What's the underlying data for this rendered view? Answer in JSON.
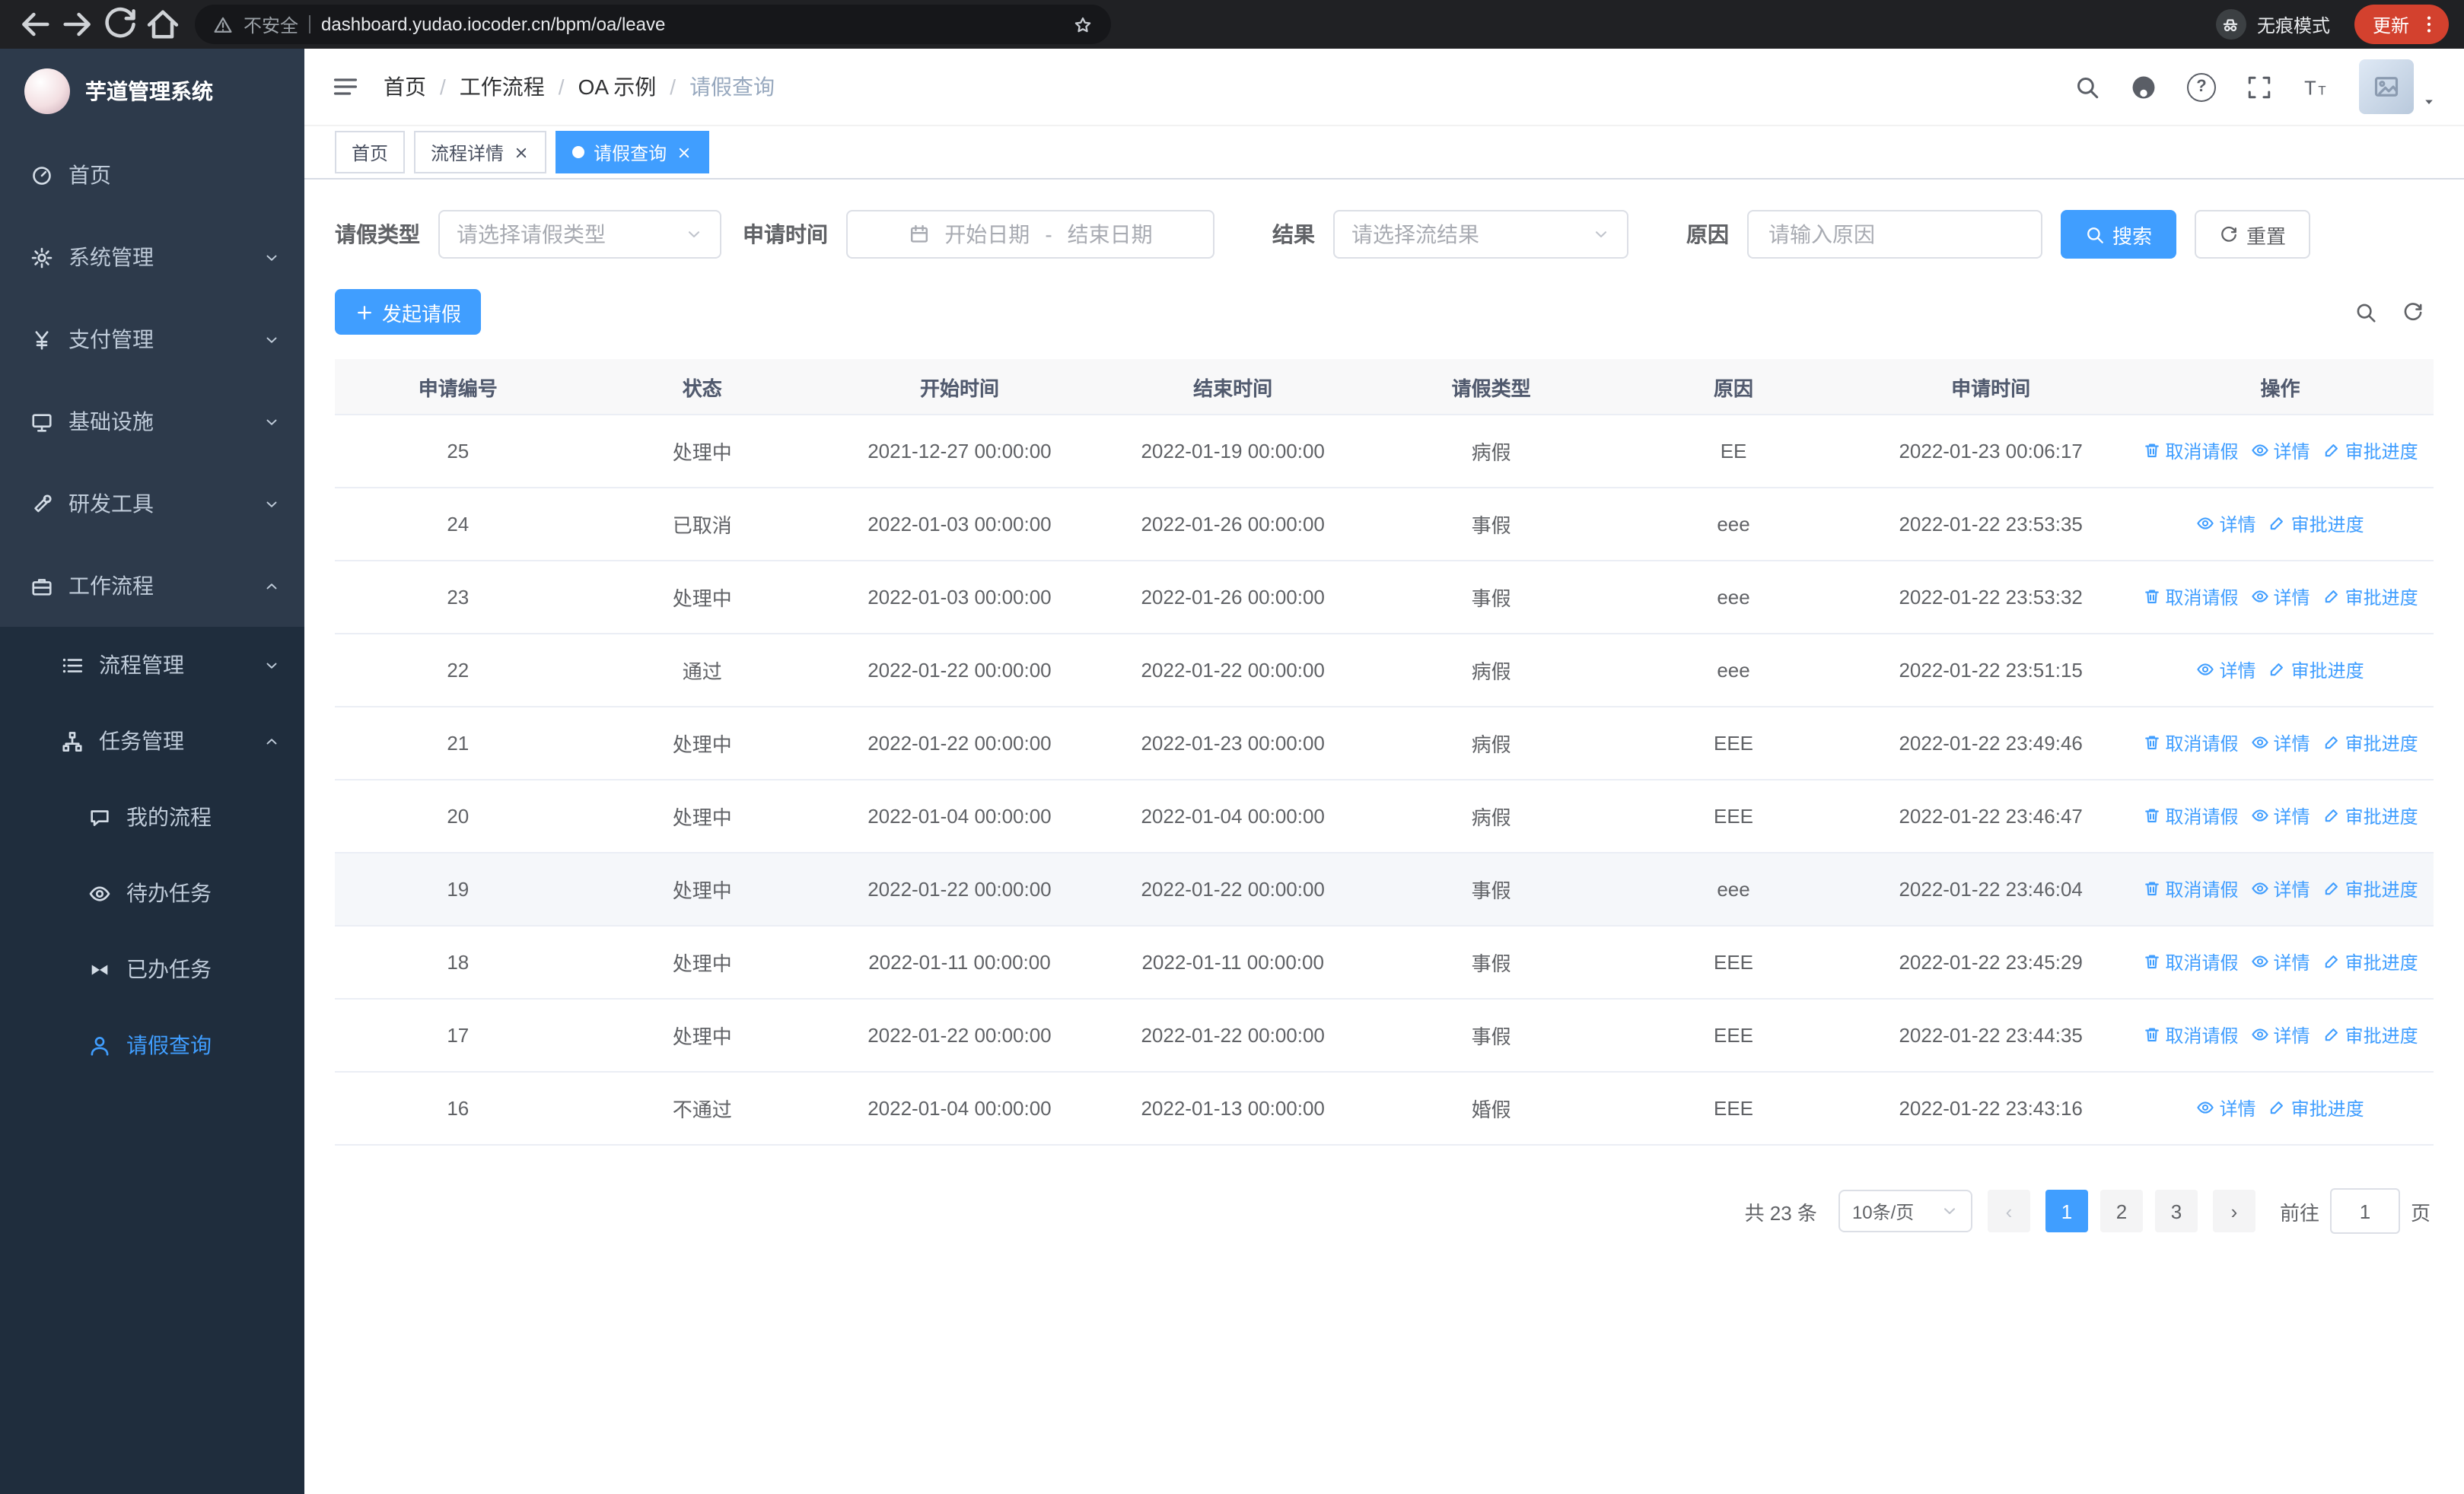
{
  "colors": {
    "primary": "#409eff",
    "sidebar_bg": "#2d3a4b",
    "submenu_bg": "#1f2d3d",
    "sidebar_text": "#bfcbd9",
    "browser_bar_bg": "#202124",
    "update_button_bg": "#d3412e",
    "table_header_bg": "#f8f8f9",
    "body_text": "#606266"
  },
  "browser": {
    "security_warning": "不安全",
    "url": "dashboard.yudao.iocoder.cn/bpm/oa/leave",
    "incognito_label": "无痕模式",
    "update_button": "更新"
  },
  "sidebar": {
    "logo_title": "芋道管理系统",
    "menu": [
      {
        "key": "home",
        "label": "首页",
        "icon": "dashboard-icon",
        "level": 1
      },
      {
        "key": "system",
        "label": "系统管理",
        "icon": "gear-icon",
        "level": 1,
        "arrow": "down"
      },
      {
        "key": "payment",
        "label": "支付管理",
        "icon": "yen-icon",
        "level": 1,
        "arrow": "down"
      },
      {
        "key": "infra",
        "label": "基础设施",
        "icon": "monitor-icon",
        "level": 1,
        "arrow": "down"
      },
      {
        "key": "devtools",
        "label": "研发工具",
        "icon": "wrench-icon",
        "level": 1,
        "arrow": "down"
      },
      {
        "key": "workflow",
        "label": "工作流程",
        "icon": "briefcase-icon",
        "level": 1,
        "arrow": "up"
      },
      {
        "key": "process-mgmt",
        "label": "流程管理",
        "icon": "list-icon",
        "level": 2,
        "arrow": "down"
      },
      {
        "key": "task-mgmt",
        "label": "任务管理",
        "icon": "tree-icon",
        "level": 2,
        "arrow": "up"
      },
      {
        "key": "my-process",
        "label": "我的流程",
        "icon": "chat-icon",
        "level": 3
      },
      {
        "key": "todo-tasks",
        "label": "待办任务",
        "icon": "eye-icon",
        "level": 3
      },
      {
        "key": "done-tasks",
        "label": "已办任务",
        "icon": "bowtie-icon",
        "level": 3
      },
      {
        "key": "leave-query",
        "label": "请假查询",
        "icon": "user-icon",
        "level": 3,
        "active": true
      }
    ]
  },
  "navbar": {
    "breadcrumb": [
      "首页",
      "工作流程",
      "OA 示例",
      "请假查询"
    ],
    "separator": "/"
  },
  "tabs": [
    {
      "label": "首页",
      "closable": false,
      "active": false
    },
    {
      "label": "流程详情",
      "closable": true,
      "active": false
    },
    {
      "label": "请假查询",
      "closable": true,
      "active": true
    }
  ],
  "filters": {
    "leave_type_label": "请假类型",
    "leave_type_placeholder": "请选择请假类型",
    "apply_time_label": "申请时间",
    "start_date_placeholder": "开始日期",
    "range_separator": "-",
    "end_date_placeholder": "结束日期",
    "result_label": "结果",
    "result_placeholder": "请选择流结果",
    "reason_label": "原因",
    "reason_placeholder": "请输入原因",
    "search_button": "搜索",
    "reset_button": "重置"
  },
  "toolbar": {
    "create_button": "发起请假"
  },
  "table": {
    "columns": [
      "申请编号",
      "状态",
      "开始时间",
      "结束时间",
      "请假类型",
      "原因",
      "申请时间",
      "操作"
    ],
    "action_labels": {
      "cancel": "取消请假",
      "detail": "详情",
      "progress": "审批进度"
    },
    "rows": [
      {
        "id": "25",
        "status": "处理中",
        "start": "2021-12-27 00:00:00",
        "end": "2022-01-19 00:00:00",
        "type": "病假",
        "reason": "EE",
        "apply_time": "2022-01-23 00:06:17",
        "actions": [
          "cancel",
          "detail",
          "progress"
        ]
      },
      {
        "id": "24",
        "status": "已取消",
        "start": "2022-01-03 00:00:00",
        "end": "2022-01-26 00:00:00",
        "type": "事假",
        "reason": "eee",
        "apply_time": "2022-01-22 23:53:35",
        "actions": [
          "detail",
          "progress"
        ]
      },
      {
        "id": "23",
        "status": "处理中",
        "start": "2022-01-03 00:00:00",
        "end": "2022-01-26 00:00:00",
        "type": "事假",
        "reason": "eee",
        "apply_time": "2022-01-22 23:53:32",
        "actions": [
          "cancel",
          "detail",
          "progress"
        ]
      },
      {
        "id": "22",
        "status": "通过",
        "start": "2022-01-22 00:00:00",
        "end": "2022-01-22 00:00:00",
        "type": "病假",
        "reason": "eee",
        "apply_time": "2022-01-22 23:51:15",
        "actions": [
          "detail",
          "progress"
        ]
      },
      {
        "id": "21",
        "status": "处理中",
        "start": "2022-01-22 00:00:00",
        "end": "2022-01-23 00:00:00",
        "type": "病假",
        "reason": "EEE",
        "apply_time": "2022-01-22 23:49:46",
        "actions": [
          "cancel",
          "detail",
          "progress"
        ]
      },
      {
        "id": "20",
        "status": "处理中",
        "start": "2022-01-04 00:00:00",
        "end": "2022-01-04 00:00:00",
        "type": "病假",
        "reason": "EEE",
        "apply_time": "2022-01-22 23:46:47",
        "actions": [
          "cancel",
          "detail",
          "progress"
        ]
      },
      {
        "id": "19",
        "status": "处理中",
        "start": "2022-01-22 00:00:00",
        "end": "2022-01-22 00:00:00",
        "type": "事假",
        "reason": "eee",
        "apply_time": "2022-01-22 23:46:04",
        "actions": [
          "cancel",
          "detail",
          "progress"
        ],
        "highlight": true
      },
      {
        "id": "18",
        "status": "处理中",
        "start": "2022-01-11 00:00:00",
        "end": "2022-01-11 00:00:00",
        "type": "事假",
        "reason": "EEE",
        "apply_time": "2022-01-22 23:45:29",
        "actions": [
          "cancel",
          "detail",
          "progress"
        ]
      },
      {
        "id": "17",
        "status": "处理中",
        "start": "2022-01-22 00:00:00",
        "end": "2022-01-22 00:00:00",
        "type": "事假",
        "reason": "EEE",
        "apply_time": "2022-01-22 23:44:35",
        "actions": [
          "cancel",
          "detail",
          "progress"
        ]
      },
      {
        "id": "16",
        "status": "不通过",
        "start": "2022-01-04 00:00:00",
        "end": "2022-01-13 00:00:00",
        "type": "婚假",
        "reason": "EEE",
        "apply_time": "2022-01-22 23:43:16",
        "actions": [
          "detail",
          "progress"
        ]
      }
    ]
  },
  "pagination": {
    "total": "共 23 条",
    "page_size": "10条/页",
    "pages": [
      "1",
      "2",
      "3"
    ],
    "active_page": "1",
    "goto_prefix": "前往",
    "goto_value": "1",
    "goto_suffix": "页"
  }
}
